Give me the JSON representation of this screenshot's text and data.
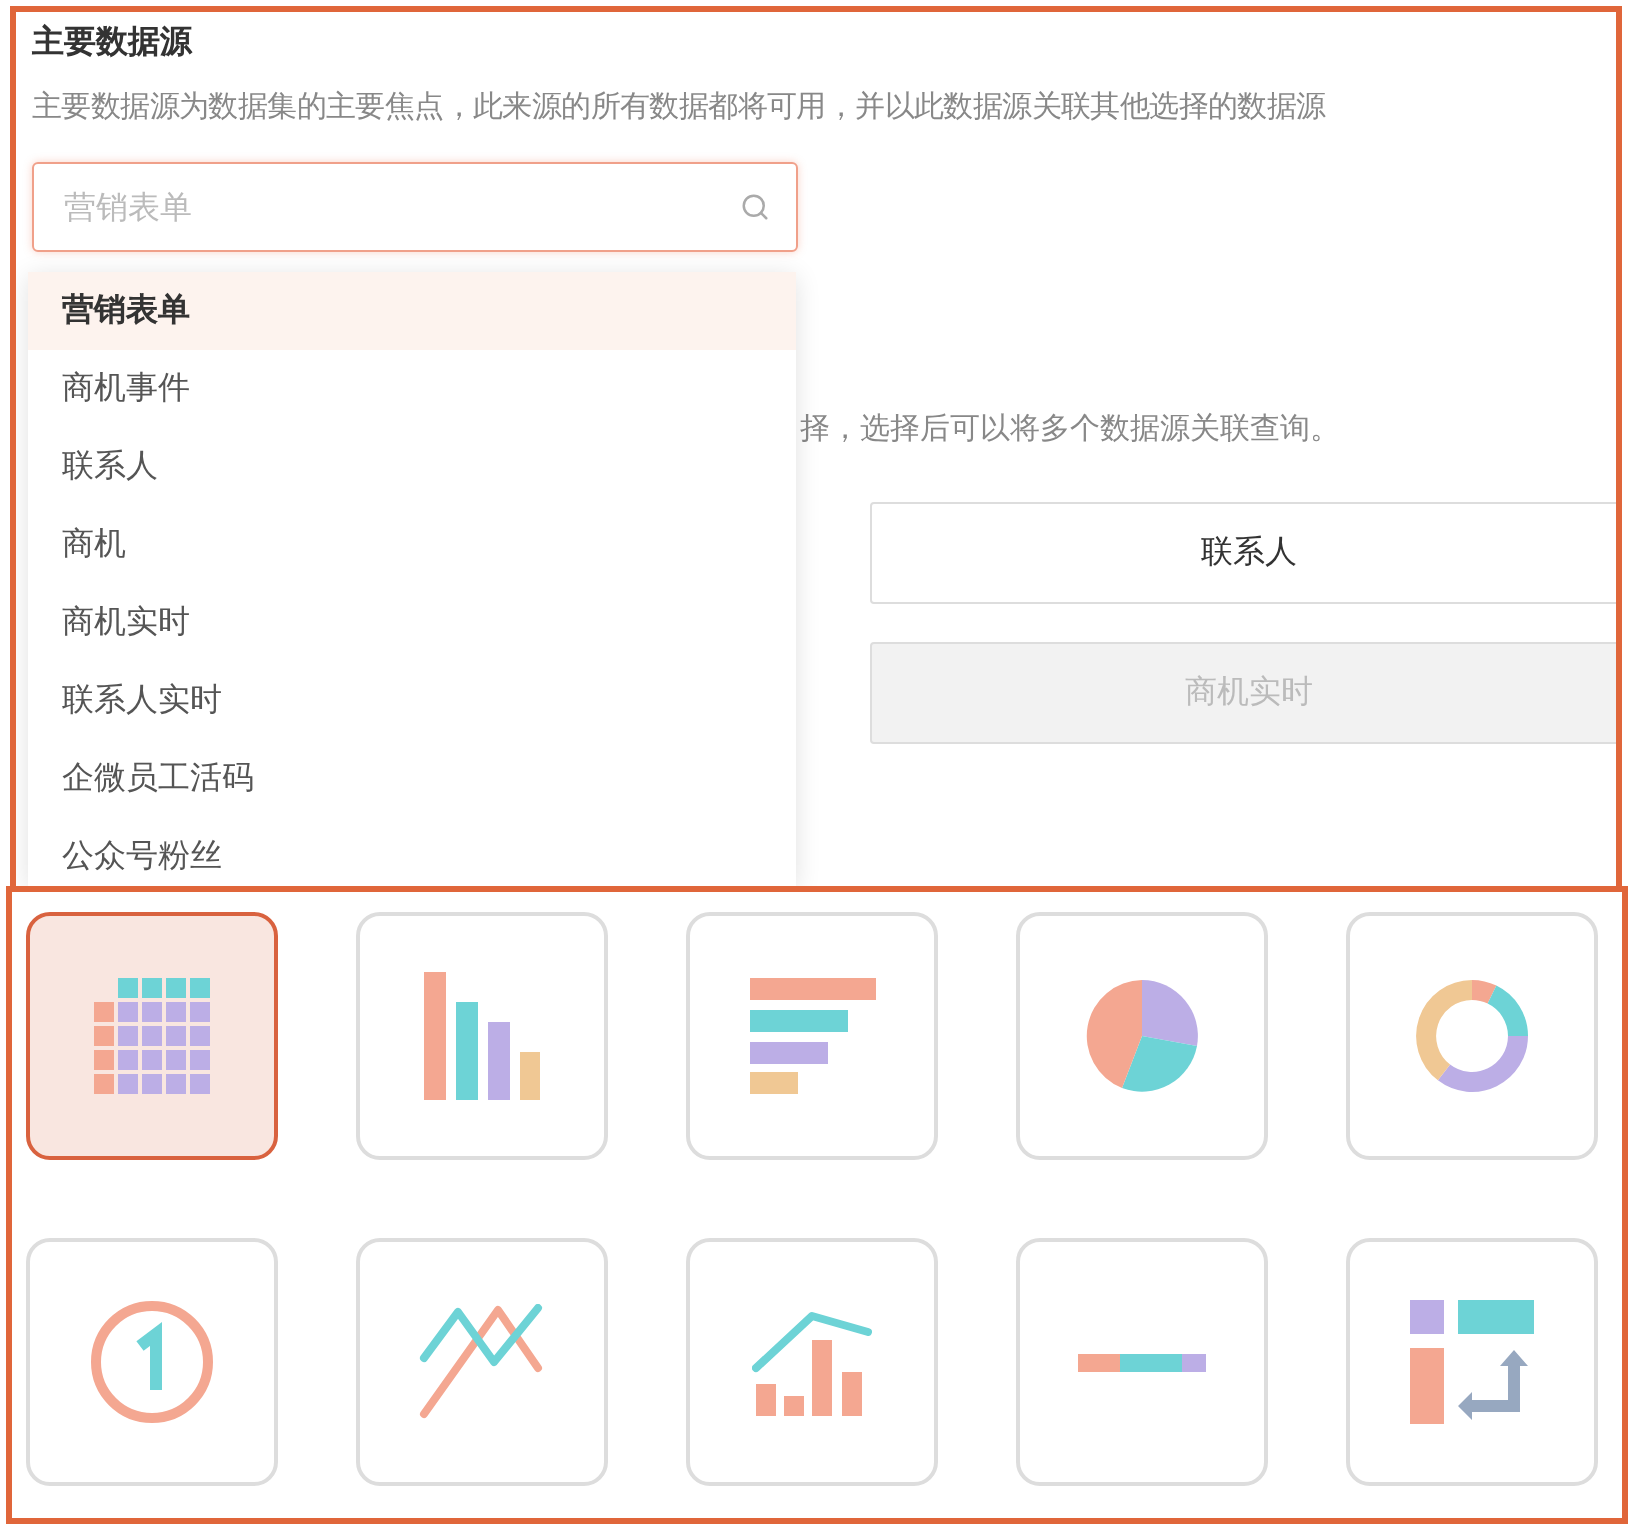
{
  "primary_source": {
    "title": "主要数据源",
    "description": "主要数据源为数据集的主要焦点，此来源的所有数据都将可用，并以此数据源关联其他选择的数据源",
    "search": {
      "placeholder": "营销表单"
    },
    "dropdown": [
      {
        "label": "营销表单",
        "selected": true
      },
      {
        "label": "商机事件",
        "selected": false
      },
      {
        "label": "联系人",
        "selected": false
      },
      {
        "label": "商机",
        "selected": false
      },
      {
        "label": "商机实时",
        "selected": false
      },
      {
        "label": "联系人实时",
        "selected": false
      },
      {
        "label": "企微员工活码",
        "selected": false
      },
      {
        "label": "公众号粉丝",
        "selected": false
      }
    ]
  },
  "related_sources": {
    "description": "择，选择后可以将多个数据源关联查询。",
    "options": [
      {
        "label": "联系人",
        "disabled": false
      },
      {
        "label": "商机实时",
        "disabled": true
      }
    ]
  },
  "chart_types": [
    {
      "kind": "table",
      "selected": true
    },
    {
      "kind": "column",
      "selected": false
    },
    {
      "kind": "bar",
      "selected": false
    },
    {
      "kind": "pie",
      "selected": false
    },
    {
      "kind": "donut",
      "selected": false
    },
    {
      "kind": "number",
      "selected": false
    },
    {
      "kind": "line",
      "selected": false
    },
    {
      "kind": "combo",
      "selected": false
    },
    {
      "kind": "progress",
      "selected": false
    },
    {
      "kind": "pivot",
      "selected": false
    }
  ]
}
